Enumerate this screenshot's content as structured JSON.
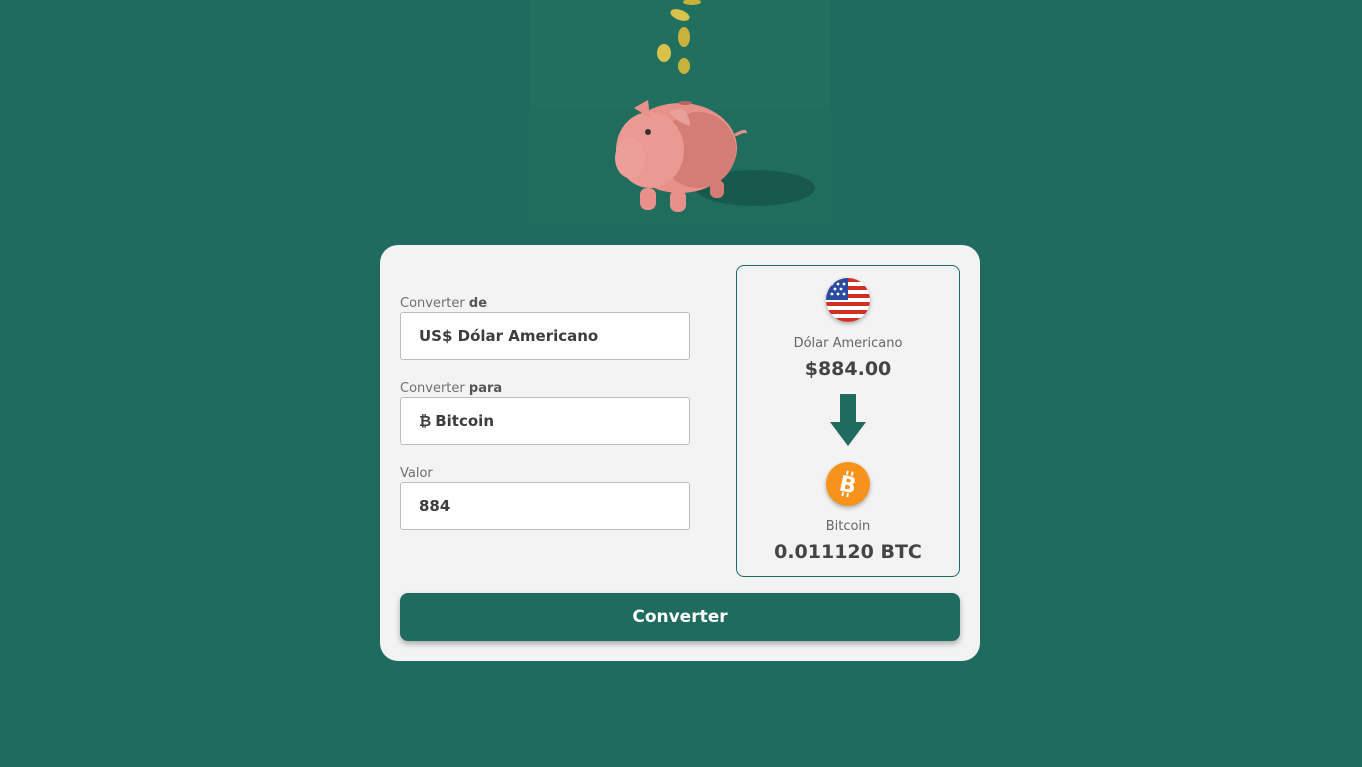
{
  "colors": {
    "background": "#1f6b60",
    "card": "#f3f3f3",
    "accent": "#1f6b60",
    "bitcoin": "#f7931a",
    "pig": "#e8918a"
  },
  "hero": {
    "illustration": "piggy-bank-with-falling-coins"
  },
  "form": {
    "from_label_prefix": "Converter",
    "from_label_bold": "de",
    "from_value": "US$ Dólar Americano",
    "to_label_prefix": "Converter",
    "to_label_bold": "para",
    "to_symbol": "₿",
    "to_value": "Bitcoin",
    "amount_label": "Valor",
    "amount_value": "884"
  },
  "result": {
    "from_icon": "us-flag-icon",
    "from_name": "Dólar Americano",
    "from_value": "$884.00",
    "arrow_icon": "arrow-down-icon",
    "to_icon": "bitcoin-icon",
    "to_name": "Bitcoin",
    "to_value": "0.011120 BTC"
  },
  "button": {
    "label": "Converter"
  }
}
